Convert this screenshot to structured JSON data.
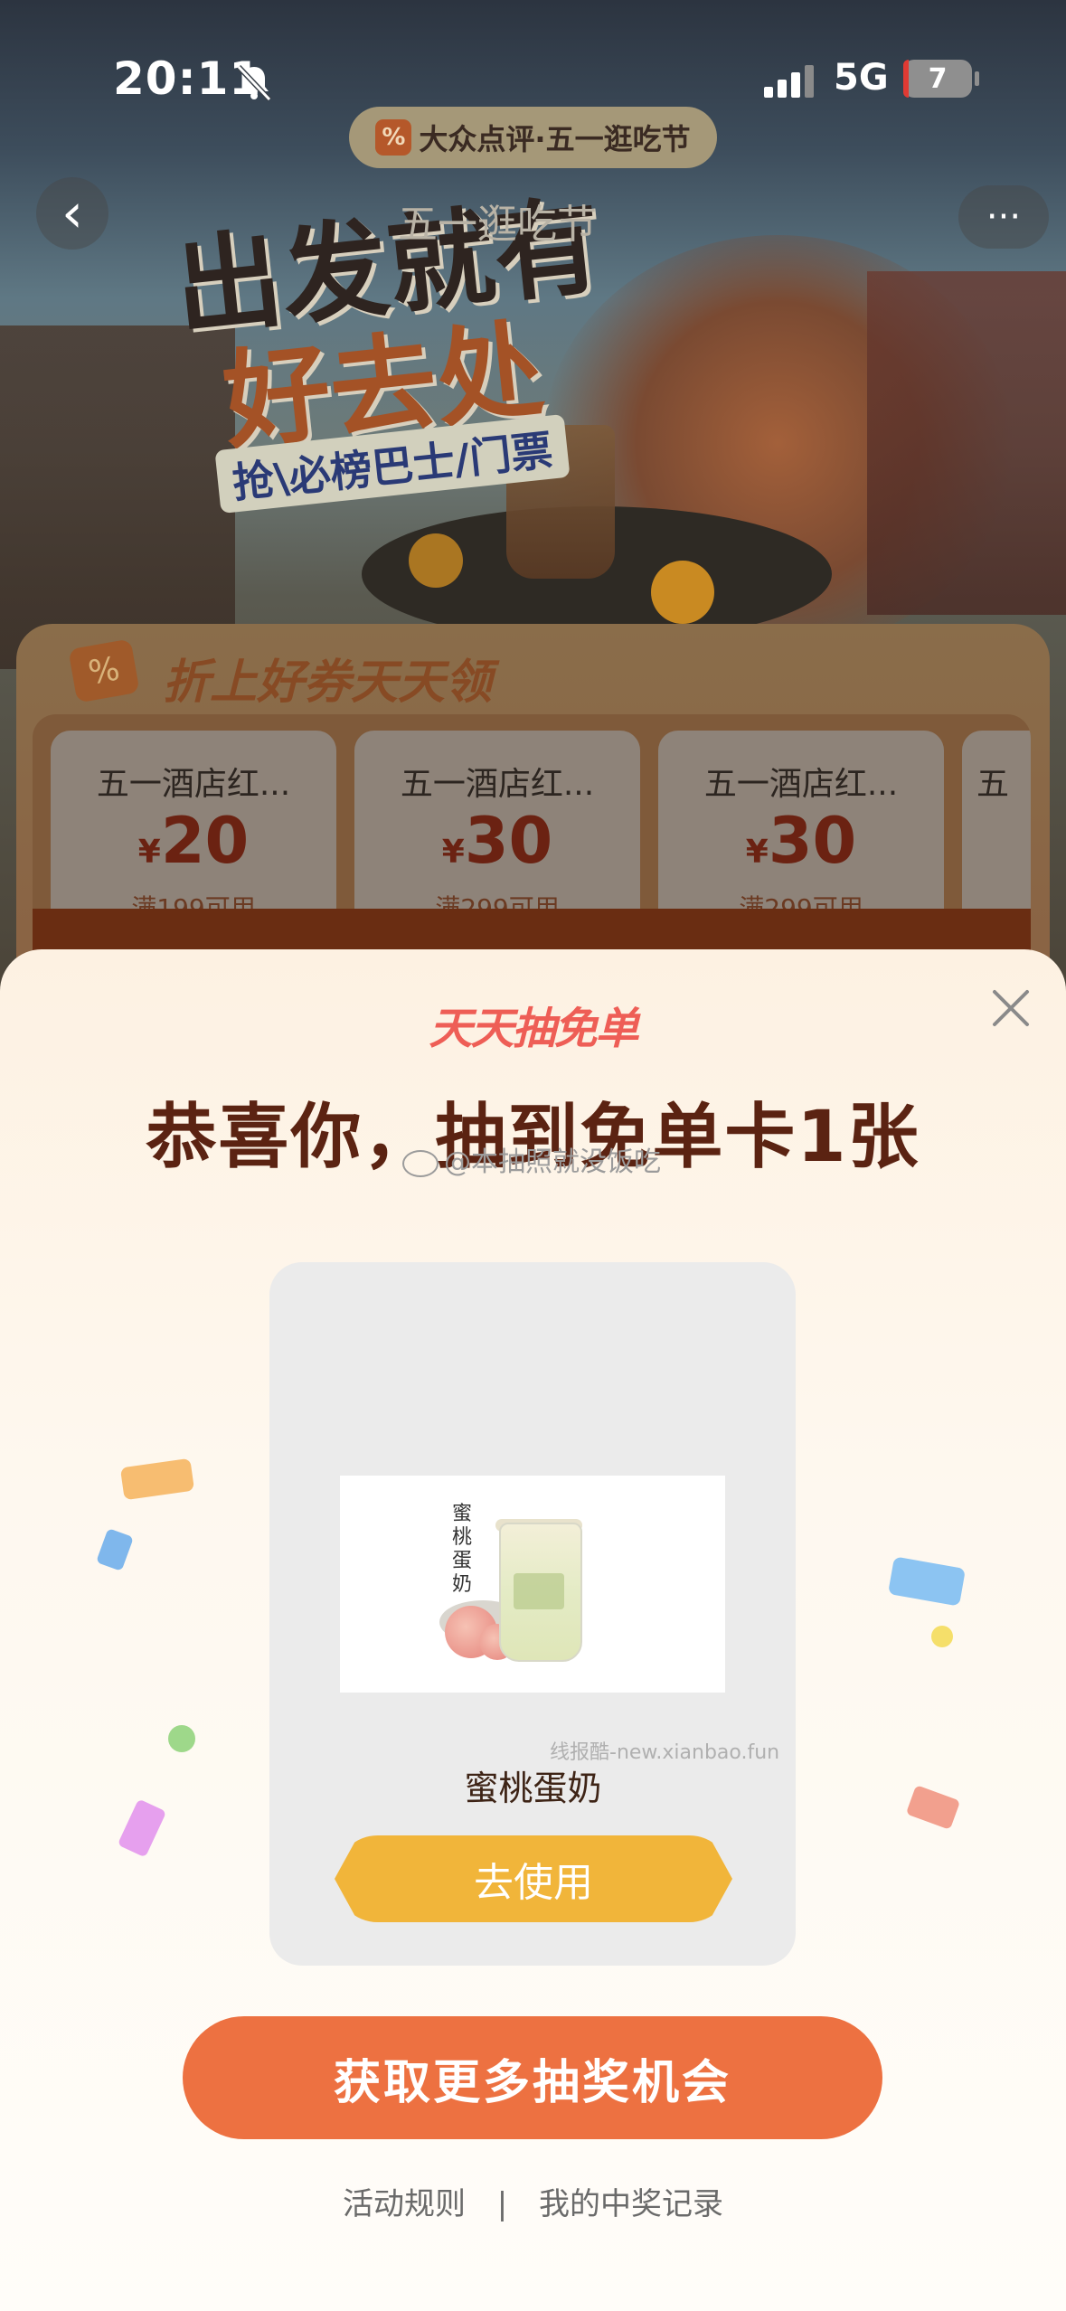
{
  "status_bar": {
    "time": "20:11",
    "network": "5G",
    "battery": "7"
  },
  "background": {
    "brand_pill": "大众点评·五一逛吃节",
    "brand_logo_glyph": "%",
    "nav_title": "五一逛吃节",
    "back_glyph": "‹",
    "more_glyph": "···",
    "hero_line1": "出发就有",
    "hero_line2": "好去处",
    "hero_sub": "抢\\必榜巴士/门票",
    "coupon_section_title": "折上好券天天领",
    "coupon_badge": "%",
    "coupons": [
      {
        "name": "五一酒店红...",
        "currency": "¥",
        "amount": "20",
        "condition": "满199可用"
      },
      {
        "name": "五一酒店红...",
        "currency": "¥",
        "amount": "30",
        "condition": "满299可用"
      },
      {
        "name": "五一酒店红...",
        "currency": "¥",
        "amount": "30",
        "condition": "满299可用"
      },
      {
        "name": "五",
        "currency": "",
        "amount": "",
        "condition": ""
      }
    ]
  },
  "modal": {
    "brand": "天天抽免单",
    "title": "恭喜你，抽到免单卡1张",
    "watermark": "@本抽照就没饭吃",
    "product_image_text": "蜜桃蛋奶",
    "product_name": "蜜桃蛋奶",
    "image_watermark": "线报酷-new.xianbao.fun",
    "use_button": "去使用",
    "more_button": "获取更多抽奖机会",
    "links": {
      "rules": "活动规则",
      "separator": "|",
      "records": "我的中奖记录"
    }
  },
  "colors": {
    "accent_orange": "#ed7141",
    "use_button_yellow": "#f1b53a",
    "title_brown": "#5b2312",
    "brand_red": "#ee5e56"
  },
  "icons": [
    "bell-muted-icon",
    "signal-icon",
    "battery-icon",
    "back-icon",
    "more-icon",
    "close-icon",
    "wechat-weibo-icon"
  ]
}
